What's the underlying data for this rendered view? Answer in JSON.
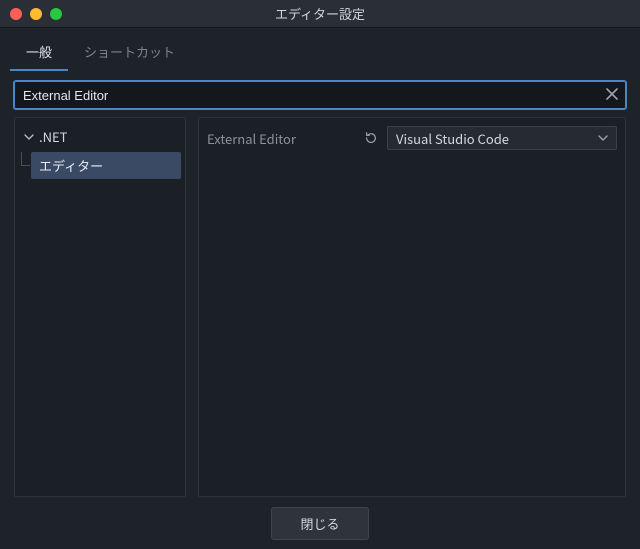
{
  "window": {
    "title": "エディター設定"
  },
  "tabs": {
    "general": "一般",
    "shortcuts": "ショートカット"
  },
  "search": {
    "value": "External Editor"
  },
  "tree": {
    "category": ".NET",
    "item": "エディター"
  },
  "property": {
    "label": "External Editor",
    "value": "Visual Studio Code"
  },
  "footer": {
    "close": "閉じる"
  }
}
